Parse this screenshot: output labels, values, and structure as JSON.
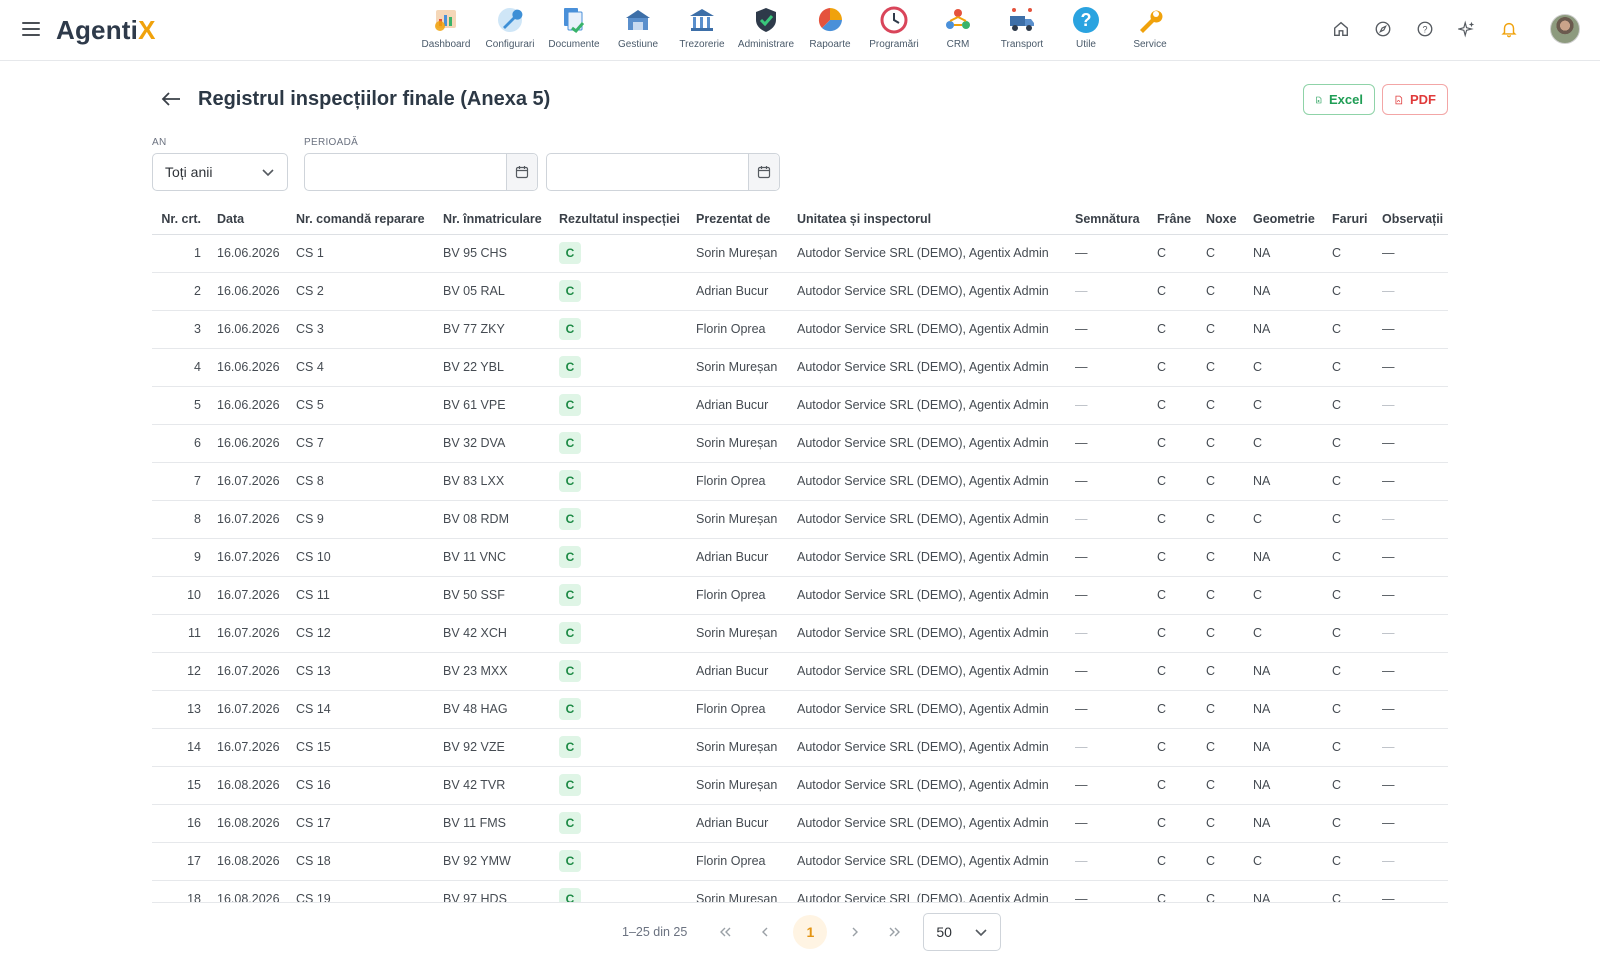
{
  "app": {
    "logo_main": "Agenti",
    "logo_accent": "X"
  },
  "modules": [
    {
      "label": "Dashboard",
      "icon": "dashboard-icon"
    },
    {
      "label": "Configurari",
      "icon": "config-wrench-icon"
    },
    {
      "label": "Documente",
      "icon": "documents-icon"
    },
    {
      "label": "Gestiune",
      "icon": "warehouse-icon"
    },
    {
      "label": "Trezorerie",
      "icon": "treasury-bank-icon"
    },
    {
      "label": "Administrare",
      "icon": "admin-shield-icon"
    },
    {
      "label": "Rapoarte",
      "icon": "reports-chart-icon"
    },
    {
      "label": "Programări",
      "icon": "schedule-clock-icon"
    },
    {
      "label": "CRM",
      "icon": "crm-icon"
    },
    {
      "label": "Transport",
      "icon": "transport-truck-icon"
    },
    {
      "label": "Utile",
      "icon": "help-question-icon"
    },
    {
      "label": "Service",
      "icon": "service-wrench-icon"
    }
  ],
  "header": {
    "title": "Registrul inspecțiilor finale (Anexa 5)",
    "excel_label": "Excel",
    "pdf_label": "PDF"
  },
  "filters": {
    "year_label": "AN",
    "year_value": "Toți anii",
    "period_label": "PERIOADĂ",
    "date_from": "",
    "date_to": ""
  },
  "table": {
    "columns": [
      "Nr. crt.",
      "Data",
      "Nr. comandă reparare",
      "Nr. înmatriculare",
      "Rezultatul inspecției",
      "Prezentat de",
      "Unitatea și inspectorul",
      "Semnătura",
      "Frâne",
      "Noxe",
      "Geometrie",
      "Faruri",
      "Observații"
    ],
    "rows": [
      {
        "nr": "1",
        "data": "16.06.2026",
        "comanda": "CS 1",
        "inmatriculare": "BV 95 CHS",
        "rezultat": "C",
        "prezentat": "Sorin Mureșan",
        "unitate": "Autodor Service SRL (DEMO), Agentix Admin",
        "semnatura": "—",
        "frane": "C",
        "noxe": "C",
        "geometrie": "NA",
        "faruri": "C",
        "observatii": "—"
      },
      {
        "nr": "2",
        "data": "16.06.2026",
        "comanda": "CS 2",
        "inmatriculare": "BV 05 RAL",
        "rezultat": "C",
        "prezentat": "Adrian Bucur",
        "unitate": "Autodor Service SRL (DEMO), Agentix Admin",
        "semnatura": "—",
        "frane": "C",
        "noxe": "C",
        "geometrie": "NA",
        "faruri": "C",
        "observatii": "—"
      },
      {
        "nr": "3",
        "data": "16.06.2026",
        "comanda": "CS 3",
        "inmatriculare": "BV 77 ZKY",
        "rezultat": "C",
        "prezentat": "Florin Oprea",
        "unitate": "Autodor Service SRL (DEMO), Agentix Admin",
        "semnatura": "—",
        "frane": "C",
        "noxe": "C",
        "geometrie": "NA",
        "faruri": "C",
        "observatii": "—"
      },
      {
        "nr": "4",
        "data": "16.06.2026",
        "comanda": "CS 4",
        "inmatriculare": "BV 22 YBL",
        "rezultat": "C",
        "prezentat": "Sorin Mureșan",
        "unitate": "Autodor Service SRL (DEMO), Agentix Admin",
        "semnatura": "—",
        "frane": "C",
        "noxe": "C",
        "geometrie": "C",
        "faruri": "C",
        "observatii": "—"
      },
      {
        "nr": "5",
        "data": "16.06.2026",
        "comanda": "CS 5",
        "inmatriculare": "BV 61 VPE",
        "rezultat": "C",
        "prezentat": "Adrian Bucur",
        "unitate": "Autodor Service SRL (DEMO), Agentix Admin",
        "semnatura": "—",
        "frane": "C",
        "noxe": "C",
        "geometrie": "C",
        "faruri": "C",
        "observatii": "—"
      },
      {
        "nr": "6",
        "data": "16.06.2026",
        "comanda": "CS 7",
        "inmatriculare": "BV 32 DVA",
        "rezultat": "C",
        "prezentat": "Sorin Mureșan",
        "unitate": "Autodor Service SRL (DEMO), Agentix Admin",
        "semnatura": "—",
        "frane": "C",
        "noxe": "C",
        "geometrie": "C",
        "faruri": "C",
        "observatii": "—"
      },
      {
        "nr": "7",
        "data": "16.07.2026",
        "comanda": "CS 8",
        "inmatriculare": "BV 83 LXX",
        "rezultat": "C",
        "prezentat": "Florin Oprea",
        "unitate": "Autodor Service SRL (DEMO), Agentix Admin",
        "semnatura": "—",
        "frane": "C",
        "noxe": "C",
        "geometrie": "NA",
        "faruri": "C",
        "observatii": "—"
      },
      {
        "nr": "8",
        "data": "16.07.2026",
        "comanda": "CS 9",
        "inmatriculare": "BV 08 RDM",
        "rezultat": "C",
        "prezentat": "Sorin Mureșan",
        "unitate": "Autodor Service SRL (DEMO), Agentix Admin",
        "semnatura": "—",
        "frane": "C",
        "noxe": "C",
        "geometrie": "C",
        "faruri": "C",
        "observatii": "—"
      },
      {
        "nr": "9",
        "data": "16.07.2026",
        "comanda": "CS 10",
        "inmatriculare": "BV 11 VNC",
        "rezultat": "C",
        "prezentat": "Adrian Bucur",
        "unitate": "Autodor Service SRL (DEMO), Agentix Admin",
        "semnatura": "—",
        "frane": "C",
        "noxe": "C",
        "geometrie": "NA",
        "faruri": "C",
        "observatii": "—"
      },
      {
        "nr": "10",
        "data": "16.07.2026",
        "comanda": "CS 11",
        "inmatriculare": "BV 50 SSF",
        "rezultat": "C",
        "prezentat": "Florin Oprea",
        "unitate": "Autodor Service SRL (DEMO), Agentix Admin",
        "semnatura": "—",
        "frane": "C",
        "noxe": "C",
        "geometrie": "C",
        "faruri": "C",
        "observatii": "—"
      },
      {
        "nr": "11",
        "data": "16.07.2026",
        "comanda": "CS 12",
        "inmatriculare": "BV 42 XCH",
        "rezultat": "C",
        "prezentat": "Sorin Mureșan",
        "unitate": "Autodor Service SRL (DEMO), Agentix Admin",
        "semnatura": "—",
        "frane": "C",
        "noxe": "C",
        "geometrie": "C",
        "faruri": "C",
        "observatii": "—"
      },
      {
        "nr": "12",
        "data": "16.07.2026",
        "comanda": "CS 13",
        "inmatriculare": "BV 23 MXX",
        "rezultat": "C",
        "prezentat": "Adrian Bucur",
        "unitate": "Autodor Service SRL (DEMO), Agentix Admin",
        "semnatura": "—",
        "frane": "C",
        "noxe": "C",
        "geometrie": "NA",
        "faruri": "C",
        "observatii": "—"
      },
      {
        "nr": "13",
        "data": "16.07.2026",
        "comanda": "CS 14",
        "inmatriculare": "BV 48 HAG",
        "rezultat": "C",
        "prezentat": "Florin Oprea",
        "unitate": "Autodor Service SRL (DEMO), Agentix Admin",
        "semnatura": "—",
        "frane": "C",
        "noxe": "C",
        "geometrie": "NA",
        "faruri": "C",
        "observatii": "—"
      },
      {
        "nr": "14",
        "data": "16.07.2026",
        "comanda": "CS 15",
        "inmatriculare": "BV 92 VZE",
        "rezultat": "C",
        "prezentat": "Sorin Mureșan",
        "unitate": "Autodor Service SRL (DEMO), Agentix Admin",
        "semnatura": "—",
        "frane": "C",
        "noxe": "C",
        "geometrie": "NA",
        "faruri": "C",
        "observatii": "—"
      },
      {
        "nr": "15",
        "data": "16.08.2026",
        "comanda": "CS 16",
        "inmatriculare": "BV 42 TVR",
        "rezultat": "C",
        "prezentat": "Sorin Mureșan",
        "unitate": "Autodor Service SRL (DEMO), Agentix Admin",
        "semnatura": "—",
        "frane": "C",
        "noxe": "C",
        "geometrie": "NA",
        "faruri": "C",
        "observatii": "—"
      },
      {
        "nr": "16",
        "data": "16.08.2026",
        "comanda": "CS 17",
        "inmatriculare": "BV 11 FMS",
        "rezultat": "C",
        "prezentat": "Adrian Bucur",
        "unitate": "Autodor Service SRL (DEMO), Agentix Admin",
        "semnatura": "—",
        "frane": "C",
        "noxe": "C",
        "geometrie": "NA",
        "faruri": "C",
        "observatii": "—"
      },
      {
        "nr": "17",
        "data": "16.08.2026",
        "comanda": "CS 18",
        "inmatriculare": "BV 92 YMW",
        "rezultat": "C",
        "prezentat": "Florin Oprea",
        "unitate": "Autodor Service SRL (DEMO), Agentix Admin",
        "semnatura": "—",
        "frane": "C",
        "noxe": "C",
        "geometrie": "C",
        "faruri": "C",
        "observatii": "—"
      },
      {
        "nr": "18",
        "data": "16.08.2026",
        "comanda": "CS 19",
        "inmatriculare": "BV 97 HDS",
        "rezultat": "C",
        "prezentat": "Sorin Mureșan",
        "unitate": "Autodor Service SRL (DEMO), Agentix Admin",
        "semnatura": "—",
        "frane": "C",
        "noxe": "C",
        "geometrie": "NA",
        "faruri": "C",
        "observatii": "—"
      }
    ]
  },
  "pagination": {
    "range": "1–25 din 25",
    "current_page": "1",
    "page_size": "50"
  },
  "colors": {
    "brand_accent": "#f0a20c",
    "badge_bg": "#dff5e6",
    "badge_text": "#1d8a45",
    "excel": "#1f9d55",
    "pdf": "#e03a3a"
  }
}
